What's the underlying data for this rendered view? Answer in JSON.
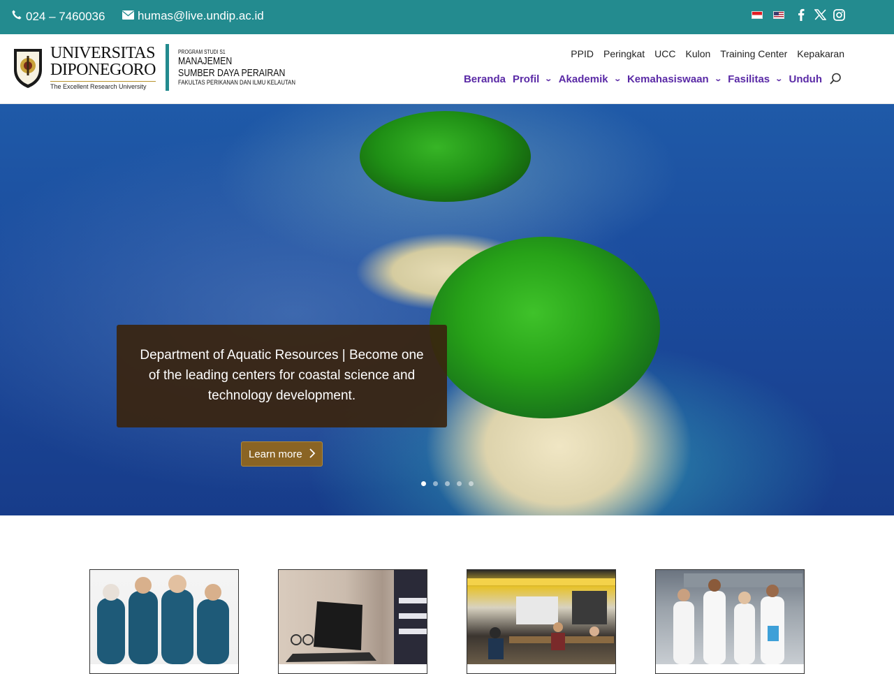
{
  "topbar": {
    "phone": "024 – 7460036",
    "email": "humas@live.undip.ac.id",
    "icons": [
      "phone-icon",
      "envelope-icon",
      "flag-id-icon",
      "flag-us-icon",
      "facebook-icon",
      "x-twitter-icon",
      "instagram-icon"
    ]
  },
  "logo": {
    "univ_line1": "UNIVERSITAS",
    "univ_line2": "DIPONEGORO",
    "tagline": "The Excellent Research University",
    "program_small": "PROGRAM STUDI S1",
    "program_line1": "MANAJEMEN",
    "program_line2": "SUMBER DAYA PERAIRAN",
    "faculty": "FAKULTAS PERIKANAN DAN ILMU KELAUTAN"
  },
  "secondary_nav": [
    "PPID",
    "Peringkat",
    "UCC",
    "Kulon",
    "Training Center",
    "Kepakaran"
  ],
  "main_nav": [
    {
      "label": "Beranda"
    },
    {
      "label": "Profil"
    },
    {
      "label": "Akademik"
    },
    {
      "label": "Kemahasiswaan"
    },
    {
      "label": "Fasilitas"
    },
    {
      "label": "Unduh"
    }
  ],
  "hero": {
    "caption": "Department of Aquatic Resources | Become one of the leading centers for coastal science and technology development.",
    "button_label": "Learn more",
    "slides_total": 5,
    "active_slide": 1
  },
  "colors": {
    "topbar": "#238b8f",
    "nav_text": "#5a2aa6",
    "caption_bg": "#3a240e",
    "button_bg": "#8a6424"
  }
}
